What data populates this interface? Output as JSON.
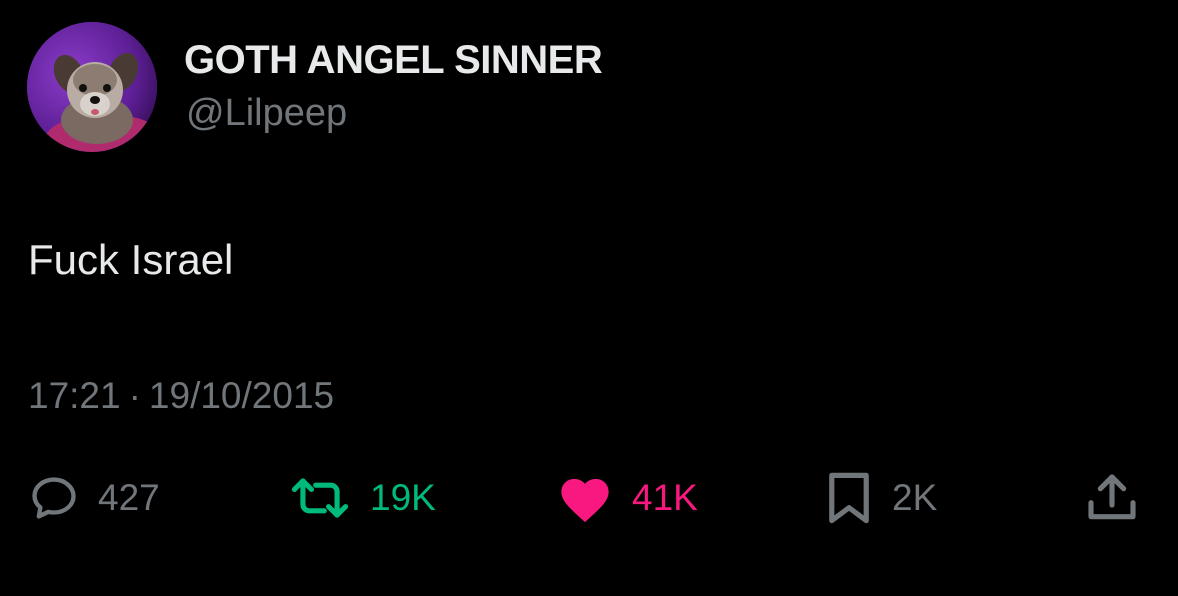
{
  "author": {
    "display_name": "GOTH ANGEL SINNER",
    "handle": "@Lilpeep",
    "avatar_icon": "dog-avatar"
  },
  "tweet": {
    "text": "Fuck Israel",
    "time": "17:21",
    "separator": "·",
    "date": "19/10/2015"
  },
  "actions": {
    "reply": {
      "icon": "comment-icon",
      "count": "427"
    },
    "retweet": {
      "icon": "retweet-icon",
      "count": "19K",
      "color": "#00ba7c"
    },
    "like": {
      "icon": "heart-icon",
      "count": "41K",
      "color": "#f91880"
    },
    "bookmark": {
      "icon": "bookmark-icon",
      "count": "2K"
    },
    "share": {
      "icon": "share-icon"
    }
  },
  "colors": {
    "background": "#000000",
    "primary_text": "#e7e9ea",
    "secondary_text": "#71767b",
    "retweet": "#00ba7c",
    "like": "#f91880"
  }
}
